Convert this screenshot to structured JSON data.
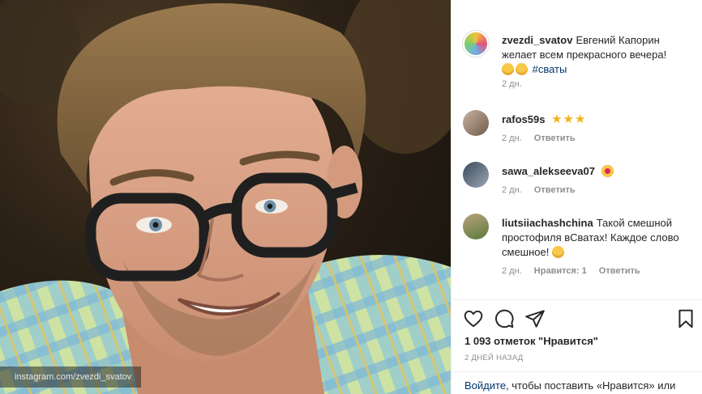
{
  "photo": {
    "watermark": "instagram.com/zvezdi_svatov"
  },
  "comments": [
    {
      "username": "zvezdi_svatov",
      "text": "Евгений Капорин желает всем прекрасного вечера!",
      "hashtag": "#сваты",
      "time": "2 дн."
    },
    {
      "username": "rafos59s",
      "stars": "★★★",
      "time": "2 дн.",
      "reply": "Ответить"
    },
    {
      "username": "sawa_alekseeva07",
      "time": "2 дн.",
      "reply": "Ответить"
    },
    {
      "username": "liutsiiachashchina",
      "text": "Такой смешной простофиля вСватах! Каждое слово смешное!",
      "time": "2 дн.",
      "likes": "Нравится: 1",
      "reply": "Ответить"
    }
  ],
  "actions": {
    "icons": [
      "heart-icon",
      "comment-icon",
      "share-icon",
      "bookmark-icon"
    ],
    "likes_count": "1 093 отметок \"Нравится\"",
    "date": "2 ДНЕЙ НАЗАД"
  },
  "login": {
    "link": "Войдите",
    "text": ", чтобы поставить «Нравится» или"
  },
  "colors": {
    "link": "#00376b",
    "muted": "#8e8e8e",
    "star": "#f2b21a"
  }
}
